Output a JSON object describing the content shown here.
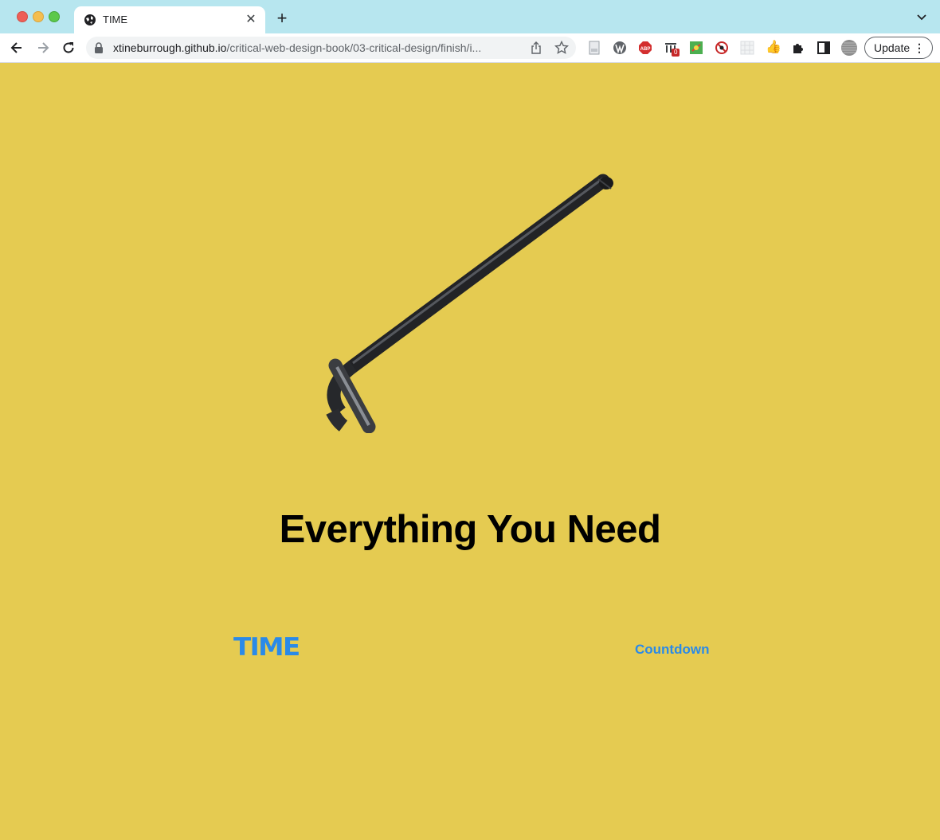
{
  "browser": {
    "tab_title": "TIME",
    "url_host": "xtineburrough.github.io",
    "url_path": "/critical-web-design-book/03-critical-design/finish/i...",
    "update_label": "Update",
    "extension_badge": "0"
  },
  "page": {
    "headline": "Everything You Need",
    "logo_text": "TIME",
    "nav_link": "Countdown",
    "background_color": "#e5cb51",
    "link_color": "#2a8ae8",
    "image_subject": "hex-key-wrench"
  }
}
